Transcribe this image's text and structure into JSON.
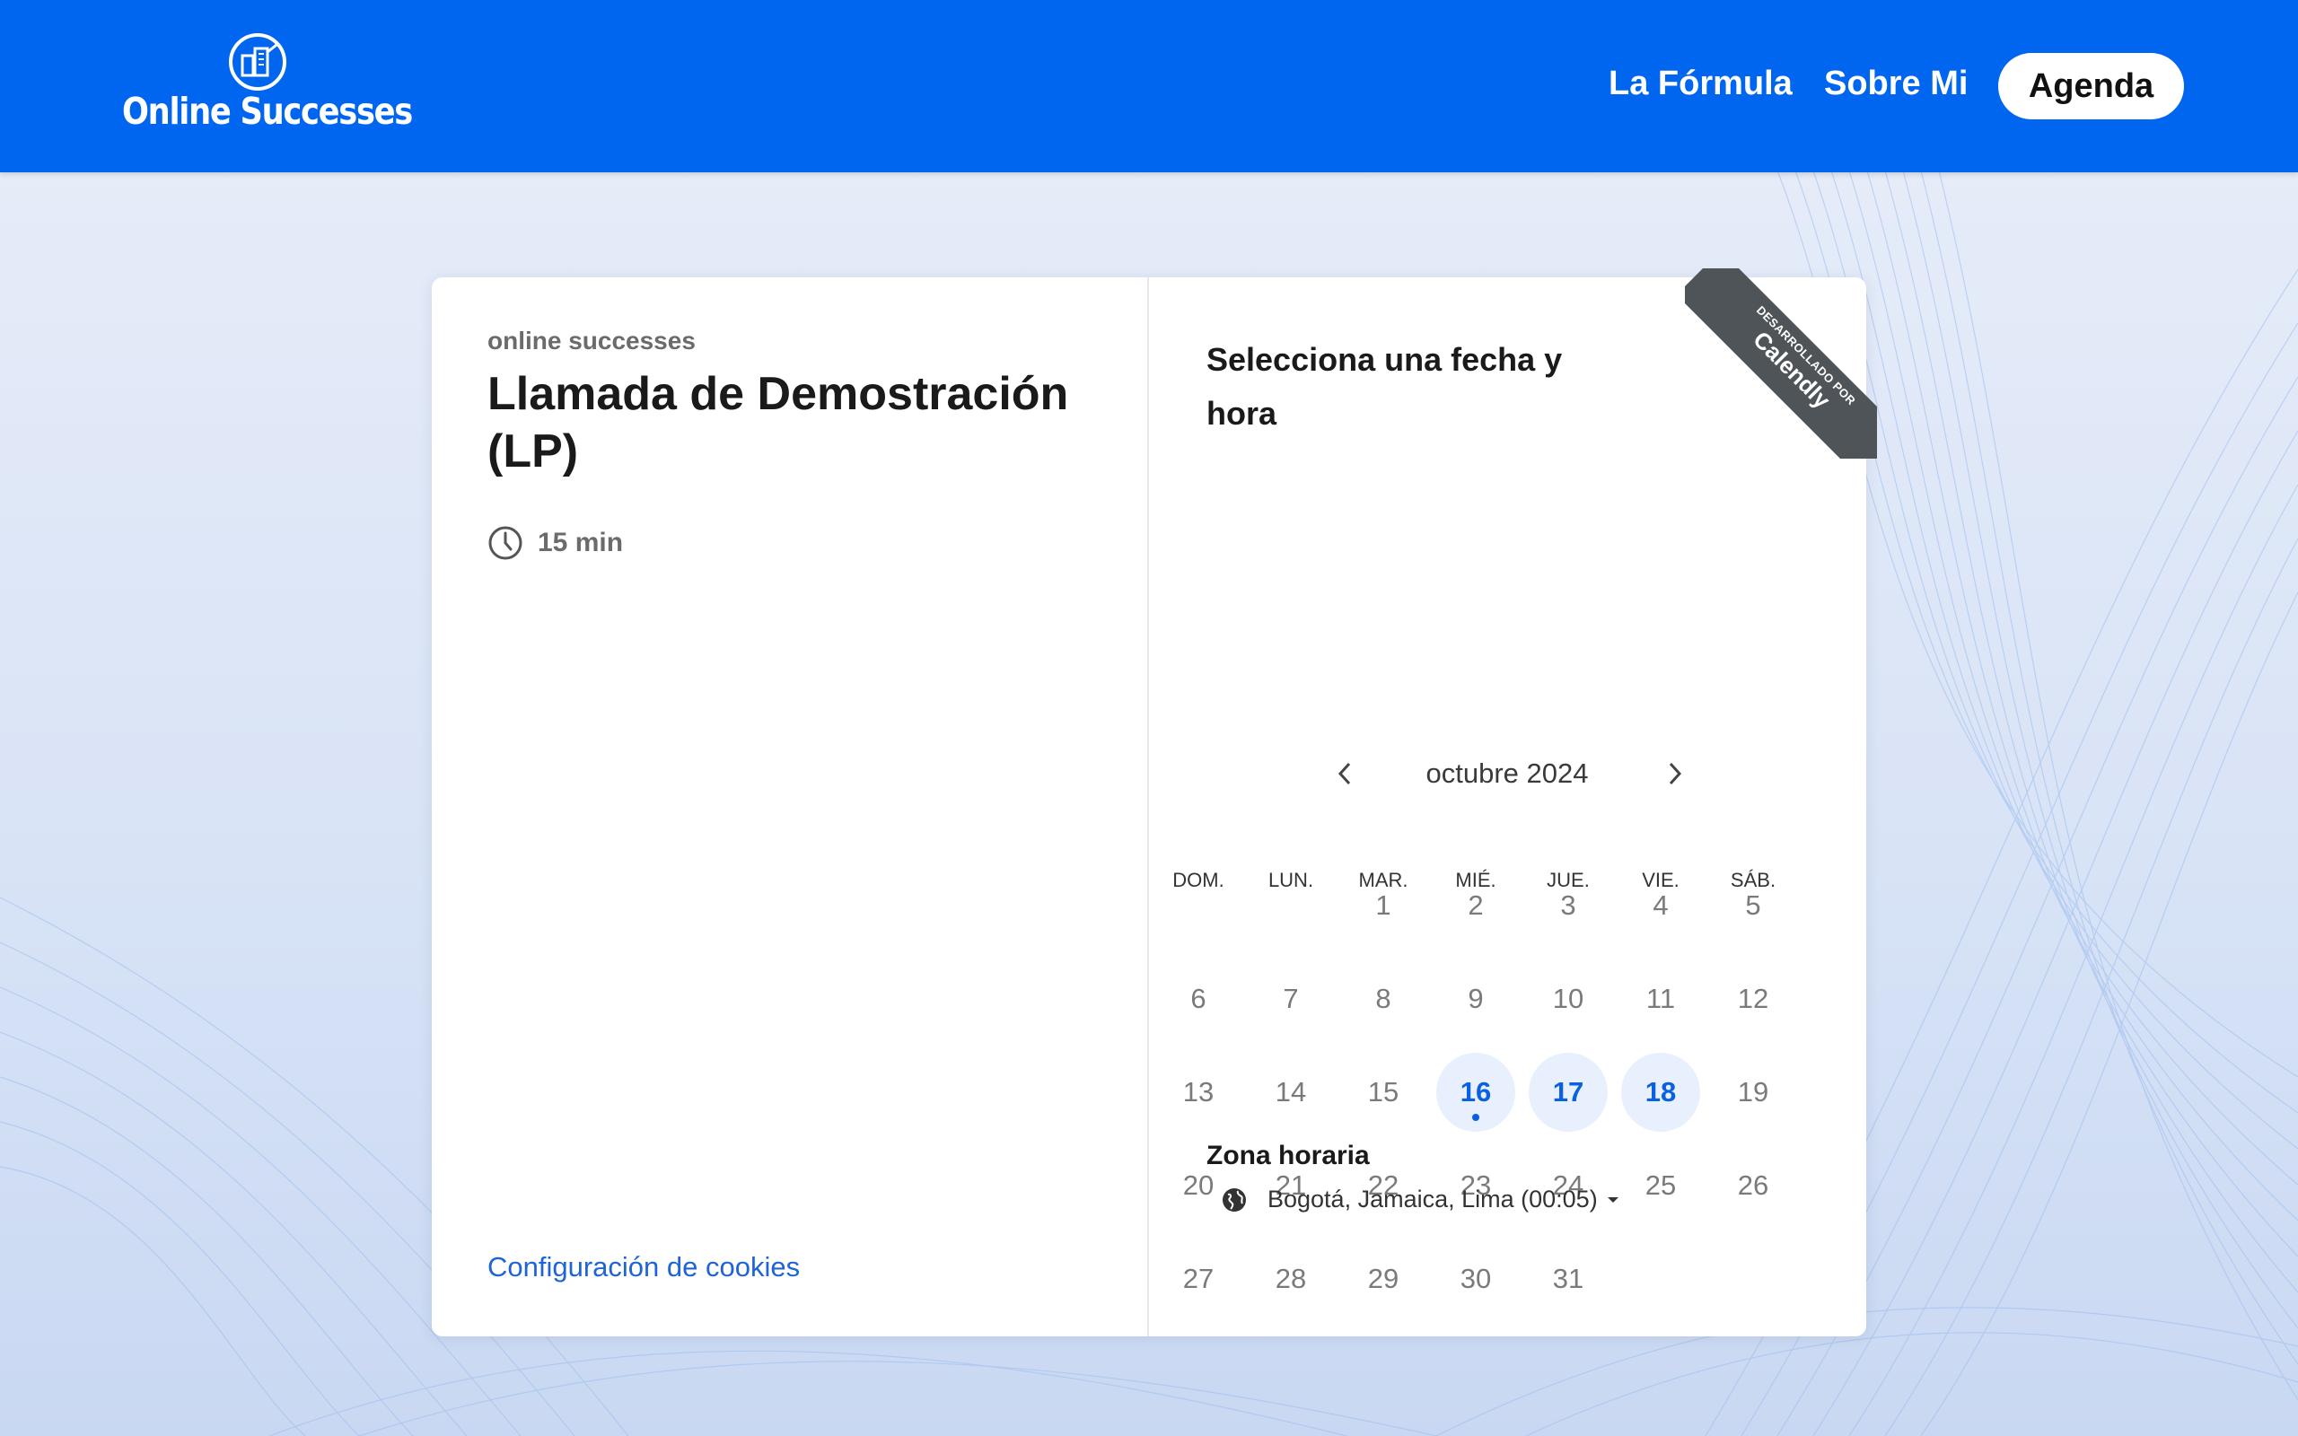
{
  "header": {
    "logo_text": "Online Successes",
    "nav": {
      "formula": "La Fórmula",
      "about": "Sobre Mi",
      "agenda": "Agenda"
    },
    "colors": {
      "brand": "#0066f0"
    }
  },
  "event": {
    "org_name": "online successes",
    "title": "Llamada de Demostración (LP)",
    "duration": "15 min",
    "cookies_link": "Configuración de cookies"
  },
  "calendar": {
    "heading": "Selecciona una fecha y hora",
    "month_label": "octubre 2024",
    "weekdays": [
      "DOM.",
      "LUN.",
      "MAR.",
      "MIÉ.",
      "JUE.",
      "VIE.",
      "SÁB."
    ],
    "first_weekday_index": 2,
    "days_in_month": 31,
    "available_days": [
      16,
      17,
      18
    ],
    "today": 16
  },
  "timezone": {
    "label": "Zona horaria",
    "value": "Bogotá, Jamaica, Lima (00:05)"
  },
  "ribbon": {
    "small": "DESARROLLADO POR",
    "big": "Calendly"
  }
}
